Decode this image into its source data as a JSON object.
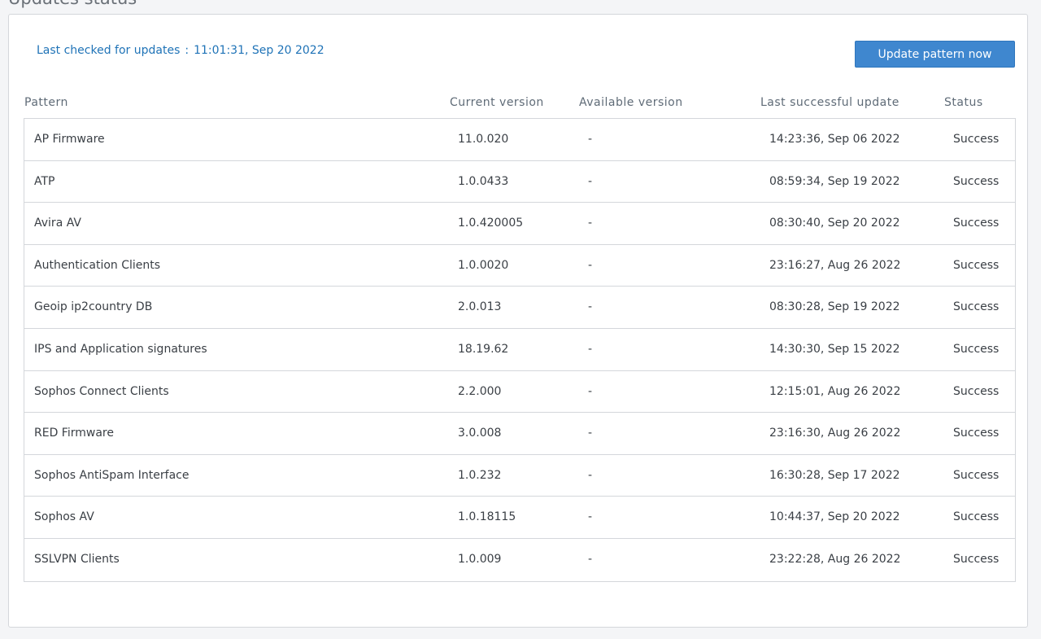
{
  "section": {
    "title": "Updates status"
  },
  "last_checked": {
    "label": "Last checked for updates",
    "separator": ":",
    "value": "11:01:31, Sep 20 2022"
  },
  "actions": {
    "update_label": "Update pattern now"
  },
  "table": {
    "headers": {
      "pattern": "Pattern",
      "current": "Current version",
      "available": "Available version",
      "last": "Last successful update",
      "status": "Status"
    },
    "rows": [
      {
        "pattern": "AP Firmware",
        "current": "11.0.020",
        "available": "-",
        "last": "14:23:36, Sep 06 2022",
        "status": "Success"
      },
      {
        "pattern": "ATP",
        "current": "1.0.0433",
        "available": "-",
        "last": "08:59:34, Sep 19 2022",
        "status": "Success"
      },
      {
        "pattern": "Avira AV",
        "current": "1.0.420005",
        "available": "-",
        "last": "08:30:40, Sep 20 2022",
        "status": "Success"
      },
      {
        "pattern": "Authentication Clients",
        "current": "1.0.0020",
        "available": "-",
        "last": "23:16:27, Aug 26 2022",
        "status": "Success"
      },
      {
        "pattern": "Geoip ip2country DB",
        "current": "2.0.013",
        "available": "-",
        "last": "08:30:28, Sep 19 2022",
        "status": "Success"
      },
      {
        "pattern": "IPS and Application signatures",
        "current": "18.19.62",
        "available": "-",
        "last": "14:30:30, Sep 15 2022",
        "status": "Success"
      },
      {
        "pattern": "Sophos Connect Clients",
        "current": "2.2.000",
        "available": "-",
        "last": "12:15:01, Aug 26 2022",
        "status": "Success"
      },
      {
        "pattern": "RED Firmware",
        "current": "3.0.008",
        "available": "-",
        "last": "23:16:30, Aug 26 2022",
        "status": "Success"
      },
      {
        "pattern": "Sophos AntiSpam Interface",
        "current": "1.0.232",
        "available": "-",
        "last": "16:30:28, Sep 17 2022",
        "status": "Success"
      },
      {
        "pattern": "Sophos AV",
        "current": "1.0.18115",
        "available": "-",
        "last": "10:44:37, Sep 20 2022",
        "status": "Success"
      },
      {
        "pattern": "SSLVPN Clients",
        "current": "1.0.009",
        "available": "-",
        "last": "23:22:28, Aug 26 2022",
        "status": "Success"
      }
    ]
  }
}
